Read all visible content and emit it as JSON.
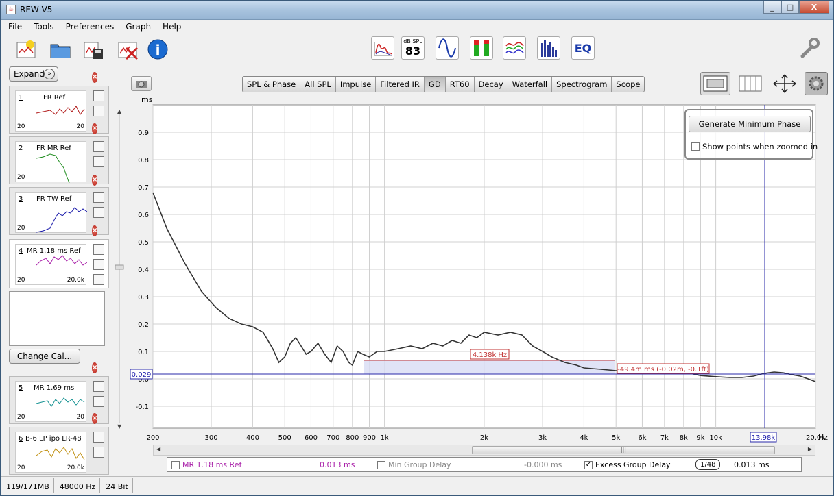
{
  "window": {
    "title": "REW V5",
    "min": "_",
    "max": "□",
    "close": "X"
  },
  "menu": [
    "File",
    "Tools",
    "Preferences",
    "Graph",
    "Help"
  ],
  "toolbar": {
    "spl_meter_label": "dB SPL",
    "spl_meter_value": "83",
    "eq_label": "EQ"
  },
  "left_panel": {
    "expand_label": "Expand",
    "change_cal_label": "Change Cal...",
    "measurements": [
      {
        "num": "1",
        "name": "FR Ref",
        "lo": "20",
        "hi": "20",
        "color": "#b01818"
      },
      {
        "num": "2",
        "name": "FR MR Ref",
        "lo": "20",
        "hi": "20",
        "color": "#1a8a1a"
      },
      {
        "num": "3",
        "name": "FR TW Ref",
        "lo": "20",
        "hi": "20",
        "color": "#1a1aaa"
      },
      {
        "num": "4",
        "name": "MR 1.18 ms Ref",
        "lo": "20",
        "hi": "20.0k",
        "color": "#aa22aa"
      },
      {
        "num": "5",
        "name": "MR 1.69 ms",
        "lo": "20",
        "hi": "20",
        "color": "#109090"
      },
      {
        "num": "6",
        "name": "B-6 LP ipo LR-48",
        "lo": "20",
        "hi": "20.0k",
        "color": "#c09010"
      }
    ]
  },
  "tabs": [
    "SPL & Phase",
    "All SPL",
    "Impulse",
    "Filtered IR",
    "GD",
    "RT60",
    "Decay",
    "Waterfall",
    "Spectrogram",
    "Scope"
  ],
  "active_tab": "GD",
  "overlay": {
    "generate_label": "Generate Minimum Phase",
    "show_points_label": "Show points when zoomed in"
  },
  "plot": {
    "y_unit": "ms",
    "x_unit": "Hz",
    "cursor_y_value": "0.029",
    "cursor_x_value": "13.98k",
    "annotation_width": "4.138k Hz",
    "annotation_delta": "-49.4m ms (-0.02m, -0.1ft)"
  },
  "chart_data": {
    "type": "line",
    "title": "",
    "xlabel": "Hz",
    "ylabel": "ms",
    "xscale": "log",
    "xlim": [
      200,
      20000
    ],
    "ylim": [
      -0.18,
      1.0
    ],
    "yticks": [
      "0.9",
      "0.8",
      "0.7",
      "0.6",
      "0.5",
      "0.4",
      "0.3",
      "0.2",
      "0.1",
      "0.0",
      "-0.1"
    ],
    "xticks": [
      "200",
      "300",
      "400",
      "500",
      "600",
      "700",
      "800",
      "900",
      "1k",
      "2k",
      "3k",
      "4k",
      "5k",
      "6k",
      "7k",
      "8k",
      "9k",
      "10k",
      "20.0k"
    ],
    "grid": true,
    "series": [
      {
        "color": "#333333",
        "x": [
          200,
          220,
          250,
          280,
          310,
          340,
          370,
          400,
          430,
          460,
          480,
          500,
          520,
          540,
          560,
          580,
          600,
          630,
          660,
          690,
          720,
          750,
          780,
          800,
          830,
          860,
          900,
          950,
          1000,
          1100,
          1200,
          1300,
          1400,
          1500,
          1600,
          1700,
          1800,
          1900,
          2000,
          2200,
          2400,
          2600,
          2800,
          3000,
          3200,
          3500,
          3800,
          4000,
          4500,
          5000,
          5500,
          6000,
          7000,
          8000,
          9000,
          10000,
          11000,
          12000,
          13000,
          14000,
          15000,
          16000,
          17000,
          18000,
          19000,
          20000
        ],
        "y": [
          0.68,
          0.55,
          0.42,
          0.32,
          0.26,
          0.22,
          0.2,
          0.19,
          0.17,
          0.11,
          0.06,
          0.08,
          0.13,
          0.15,
          0.12,
          0.09,
          0.1,
          0.13,
          0.09,
          0.06,
          0.12,
          0.1,
          0.06,
          0.05,
          0.1,
          0.09,
          0.08,
          0.1,
          0.1,
          0.11,
          0.12,
          0.11,
          0.13,
          0.12,
          0.14,
          0.13,
          0.16,
          0.15,
          0.17,
          0.16,
          0.17,
          0.16,
          0.12,
          0.1,
          0.08,
          0.06,
          0.05,
          0.04,
          0.035,
          0.03,
          0.03,
          0.035,
          0.03,
          0.025,
          0.012,
          0.008,
          0.005,
          0.005,
          0.01,
          0.02,
          0.025,
          0.022,
          0.015,
          0.01,
          0.0,
          -0.01
        ]
      }
    ]
  },
  "legend_bar": {
    "trace_name": "MR 1.18 ms Ref",
    "trace_value": "0.013 ms",
    "min_gd_label": "Min Group Delay",
    "min_gd_value": "-0.000 ms",
    "excess_gd_label": "Excess Group Delay",
    "smoothing": "1/48",
    "excess_gd_value": "0.013 ms"
  },
  "status": [
    "119/171MB",
    "48000 Hz",
    "24 Bit"
  ]
}
